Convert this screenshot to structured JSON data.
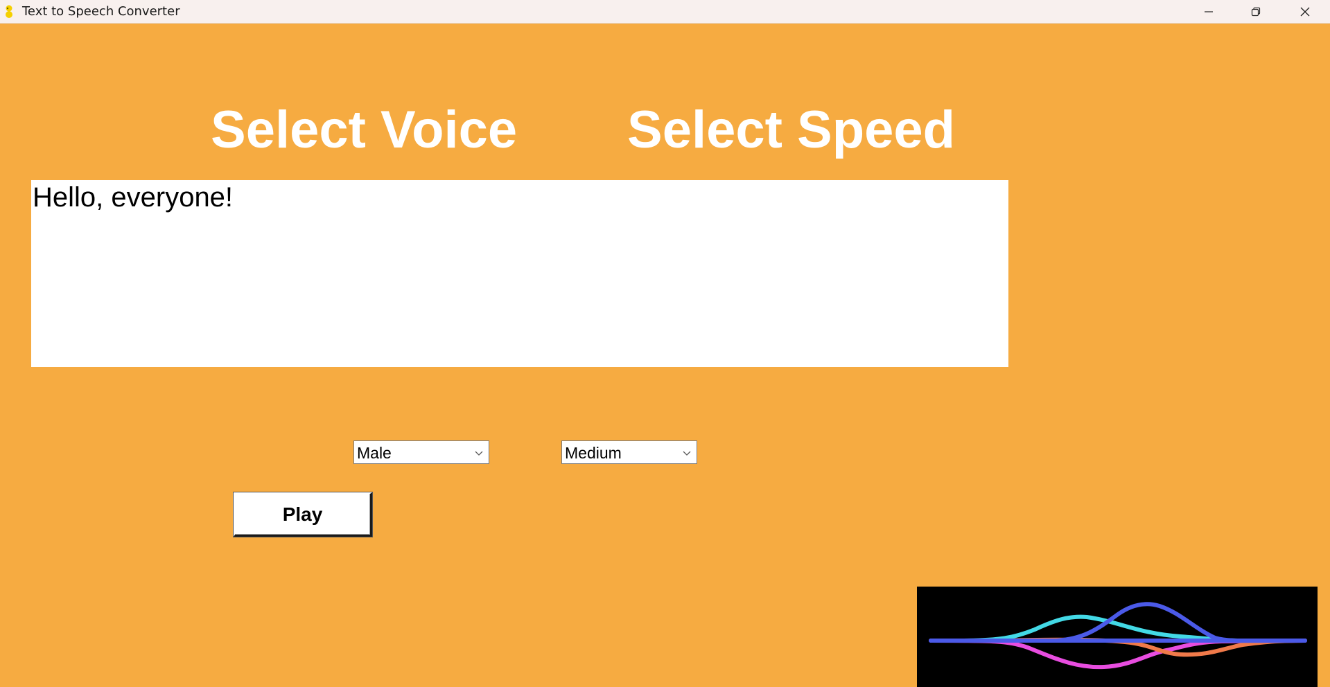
{
  "window": {
    "title": "Text to Speech Converter",
    "background_color": "#f6ab41",
    "controls": {
      "minimize_icon": "minimize-icon",
      "maximize_icon": "restore-icon",
      "close_icon": "close-icon"
    }
  },
  "labels": {
    "voice_heading": "Select Voice",
    "speed_heading": "Select Speed"
  },
  "text_input": {
    "value": "Hello, everyone!"
  },
  "voice_select": {
    "selected": "Male"
  },
  "speed_select": {
    "selected": "Medium"
  },
  "play_button": {
    "label": "Play"
  },
  "waveform": {
    "icon": "sound-wave-icon",
    "colors": [
      "#4b5ae8",
      "#43d9e6",
      "#e84de0",
      "#f07a4a"
    ]
  }
}
